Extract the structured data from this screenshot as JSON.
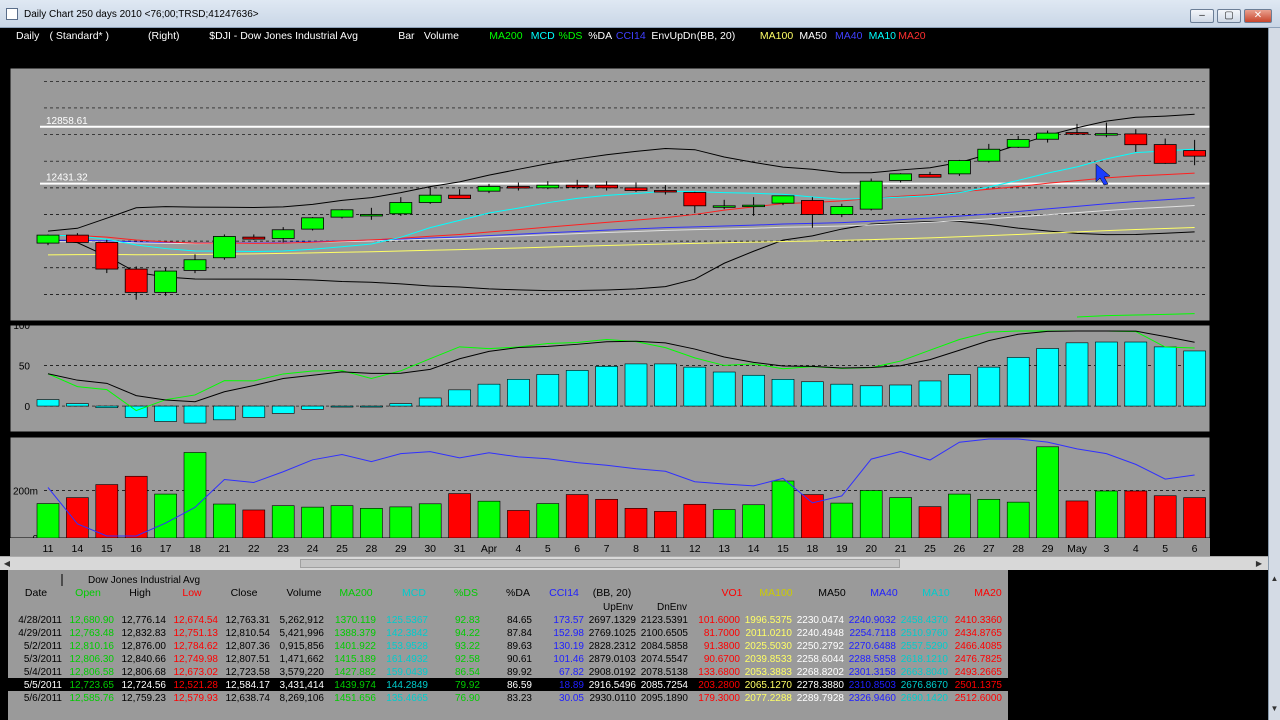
{
  "window": {
    "title": "Daily Chart 250 days 2010 <76;00;TRSD;41247636>",
    "buttons": [
      "–",
      "▢",
      "✕"
    ]
  },
  "header": {
    "items": [
      {
        "text": "Daily",
        "color": "#ffffff"
      },
      {
        "text": "(  Standard*  )",
        "color": "#ffffff"
      },
      {
        "text": "(Right)",
        "color": "#ffffff"
      },
      {
        "text": "$DJI - Dow Jones Industrial Avg",
        "color": "#ffffff"
      },
      {
        "text": "Bar",
        "color": "#ffffff"
      },
      {
        "text": "Volume",
        "color": "#ffffff"
      },
      {
        "text": "MA200",
        "color": "#00ff00"
      },
      {
        "text": "MCD",
        "color": "#00ffff"
      },
      {
        "text": "%DS",
        "color": "#00ff00"
      },
      {
        "text": "%DA",
        "color": "#ffffff"
      },
      {
        "text": "CCI14",
        "color": "#4040ff"
      },
      {
        "text": "EnvUpDn",
        "color": "#ffffff"
      },
      {
        "text": "(BB, 20)",
        "color": "#ffffff"
      },
      {
        "text": "MA100",
        "color": "#ffff66"
      },
      {
        "text": "MA50",
        "color": "#ffffff"
      },
      {
        "text": "MA40",
        "color": "#4040ff"
      },
      {
        "text": "MA10",
        "color": "#00ffff"
      },
      {
        "text": "MA20",
        "color": "#ff3030"
      }
    ]
  },
  "colors": {
    "up": "#00ff00",
    "down": "#ff0000",
    "macd": "#00ffff",
    "ma200": "#00ff00",
    "ma100": "#ffff66",
    "ma50": "#000000",
    "ma40": "#3030ff",
    "ma10": "#00ffff",
    "ma20": "#ff2020",
    "cci": "#3030ff",
    "bb": "#000000"
  },
  "price_panel": {
    "ylim": [
      11400,
      13300
    ],
    "ticks": [
      11400,
      11600,
      11800,
      12000,
      12200,
      12400,
      12600,
      12800,
      13000,
      13200
    ],
    "hlines": [
      {
        "value": 12858.61,
        "label": "12858.61"
      },
      {
        "value": 12431.32,
        "label": "12431.32"
      }
    ],
    "last_price_label": "12638.74"
  },
  "chart_data": [
    {
      "type": "candlestick",
      "categories": [
        "Mar 11",
        "Mar 14",
        "Mar 15",
        "Mar 16",
        "Mar 17",
        "Mar 18",
        "Mar 21",
        "Mar 22",
        "Mar 23",
        "Mar 24",
        "Mar 25",
        "Mar 28",
        "Mar 29",
        "Mar 30",
        "Mar 31",
        "Apr 1",
        "Apr 4",
        "Apr 5",
        "Apr 6",
        "Apr 7",
        "Apr 8",
        "Apr 11",
        "Apr 12",
        "Apr 13",
        "Apr 14",
        "Apr 15",
        "Apr 18",
        "Apr 19",
        "Apr 20",
        "Apr 21",
        "Apr 25",
        "Apr 26",
        "Apr 27",
        "Apr 28",
        "Apr 29",
        "May 2",
        "May 3",
        "May 4",
        "May 5",
        "May 6"
      ],
      "open": [
        11985,
        12045,
        11990,
        11790,
        11615,
        11780,
        11875,
        12030,
        12020,
        12090,
        12180,
        12200,
        12205,
        12290,
        12345,
        12375,
        12410,
        12400,
        12420,
        12420,
        12400,
        12380,
        12365,
        12260,
        12265,
        12285,
        12305,
        12200,
        12240,
        12455,
        12500,
        12505,
        12600,
        12705,
        12765,
        12815,
        12800,
        12805,
        12725,
        12680
      ],
      "high": [
        12050,
        12060,
        12010,
        11810,
        11800,
        11900,
        12050,
        12050,
        12105,
        12180,
        12240,
        12250,
        12330,
        12400,
        12390,
        12430,
        12440,
        12450,
        12460,
        12450,
        12440,
        12420,
        12370,
        12310,
        12330,
        12320,
        12330,
        12280,
        12470,
        12510,
        12520,
        12610,
        12730,
        12790,
        12830,
        12880,
        12890,
        12840,
        12770,
        12760
      ],
      "low": [
        11970,
        11990,
        11760,
        11560,
        11590,
        11760,
        11860,
        12010,
        11990,
        12080,
        12170,
        12160,
        12190,
        12280,
        12320,
        12360,
        12380,
        12390,
        12390,
        12380,
        12370,
        12350,
        12210,
        12240,
        12190,
        12270,
        12100,
        12180,
        12230,
        12440,
        12480,
        12490,
        12590,
        12700,
        12740,
        12800,
        12780,
        12670,
        12580,
        12570
      ],
      "close": [
        12045,
        11990,
        11790,
        11615,
        11775,
        11860,
        12035,
        12015,
        12085,
        12175,
        12235,
        12200,
        12290,
        12345,
        12320,
        12410,
        12405,
        12420,
        12405,
        12400,
        12380,
        12370,
        12265,
        12265,
        12270,
        12340,
        12200,
        12260,
        12450,
        12505,
        12480,
        12605,
        12690,
        12763,
        12811,
        12808,
        12807,
        12724,
        12584,
        12638
      ],
      "ylim": [
        11400,
        13300
      ],
      "ma200_visible": [
        11430,
        11440,
        11445,
        11450,
        11455
      ],
      "bb_upper_end": 12940,
      "bb_lower_end": 12090
    },
    {
      "type": "bar",
      "name": "MACD",
      "ticks": [
        0,
        50,
        100
      ],
      "right_ticks": [
        0,
        50,
        100
      ],
      "values": [
        8,
        3,
        -2,
        -14,
        -19,
        -21,
        -17,
        -14,
        -9,
        -4,
        0,
        0,
        3,
        10,
        20,
        27,
        33,
        39,
        44,
        49,
        52,
        52,
        48,
        42,
        38,
        33,
        30,
        27,
        25,
        26,
        31,
        39,
        48,
        60,
        71,
        78,
        79,
        79,
        73,
        68
      ]
    },
    {
      "type": "bar",
      "name": "Volume",
      "ticks": [
        {
          "v": 0,
          "label": "0"
        },
        {
          "v": 200,
          "label": "200m"
        }
      ],
      "right_ticks": [
        {
          "v": -200,
          "label": "-200"
        },
        {
          "v": 0,
          "label": "0"
        },
        {
          "v": 200,
          "label": "200"
        }
      ],
      "volume": [
        145,
        170,
        225,
        260,
        185,
        360,
        143,
        118,
        136,
        130,
        136,
        125,
        131,
        144,
        187,
        155,
        116,
        145,
        183,
        163,
        125,
        112,
        142,
        120,
        140,
        240,
        183,
        147,
        200,
        170,
        132,
        185,
        163,
        151,
        384,
        156,
        198,
        198,
        178,
        170
      ]
    }
  ],
  "x_axis_labels": [
    "11",
    "14",
    "15",
    "16",
    "17",
    "18",
    "21",
    "22",
    "23",
    "24",
    "25",
    "28",
    "29",
    "30",
    "31",
    "Apr",
    "4",
    "5",
    "6",
    "7",
    "8",
    "11",
    "12",
    "13",
    "14",
    "15",
    "18",
    "19",
    "20",
    "21",
    "25",
    "26",
    "27",
    "28",
    "29",
    "May",
    "3",
    "4",
    "5",
    "6"
  ],
  "table": {
    "top_title": "Dow Jones Industrial Avg",
    "headers": [
      {
        "text": "Date",
        "color": "#000000"
      },
      {
        "text": "Open",
        "color": "#00cc00"
      },
      {
        "text": "High",
        "color": "#000000"
      },
      {
        "text": "Low",
        "color": "#ff0000"
      },
      {
        "text": "Close",
        "color": "#000000"
      },
      {
        "text": "Volume",
        "color": "#000000"
      },
      {
        "text": "MA200",
        "color": "#00cc00"
      },
      {
        "text": "MCD",
        "color": "#00cccc"
      },
      {
        "text": "%DS",
        "color": "#00cc00"
      },
      {
        "text": "%DA",
        "color": "#000000"
      },
      {
        "text": "CCI14",
        "color": "#2020ff"
      },
      {
        "text": "(BB, 20)",
        "color": "#000000"
      },
      {
        "text": "VO1",
        "color": "#ff0000"
      },
      {
        "text": "MA100",
        "color": "#cccc00"
      },
      {
        "text": "MA50",
        "color": "#000000"
      },
      {
        "text": "MA40",
        "color": "#2020ff"
      },
      {
        "text": "MA10",
        "color": "#00cccc"
      },
      {
        "text": "MA20",
        "color": "#ff0000"
      }
    ],
    "sub_headers": [
      "UpEnv",
      "DnEnv"
    ],
    "rows": [
      [
        "4/28/2011",
        "12,680.90",
        "12,776.14",
        "12,674.54",
        "12,763.31",
        "5,262,912",
        "1370.119",
        "125.5367",
        "92.83",
        "84.65",
        "173.57",
        "2697.1329",
        "2123.5391",
        "101.6000",
        "1996.5375",
        "2230.0474",
        "2240.9032",
        "2458.4370",
        "2410.3360"
      ],
      [
        "4/29/2011",
        "12,763.48",
        "12,832.83",
        "12,751.13",
        "12,810.54",
        "5,421,996",
        "1388.379",
        "142.3842",
        "94.22",
        "87.84",
        "152.98",
        "2769.1025",
        "2100.6505",
        "81.7000",
        "2011.0210",
        "2240.4948",
        "2254.7118",
        "2510.9760",
        "2434.8765"
      ],
      [
        "5/2/2011",
        "12,810.16",
        "12,876.00",
        "12,784.62",
        "12,807.36",
        "0,915,856",
        "1401.922",
        "153.9528",
        "93.22",
        "89.63",
        "130.19",
        "2828.2312",
        "2084.5858",
        "91.3800",
        "2025.5030",
        "2250.2792",
        "2270.6488",
        "2557.5290",
        "2466.4085"
      ],
      [
        "5/3/2011",
        "12,806.30",
        "12,840.66",
        "12,749.98",
        "12,807.51",
        "1,471,662",
        "1415.189",
        "161.4932",
        "92.58",
        "90.61",
        "101.46",
        "2879.0103",
        "2074.5547",
        "90.6700",
        "2039.8533",
        "2258.6044",
        "2288.5858",
        "2618.1210",
        "2476.7825"
      ],
      [
        "5/4/2011",
        "12,806.58",
        "12,806.68",
        "12,673.02",
        "12,723.58",
        "3,579,220",
        "1427.882",
        "159.0439",
        "86.54",
        "89.92",
        "67.82",
        "2908.0192",
        "2078.5138",
        "133.6800",
        "2053.3883",
        "2268.8202",
        "2301.3158",
        "2663.8040",
        "2493.2665"
      ],
      [
        "5/5/2011",
        "12,723.65",
        "12,724.56",
        "12,521.28",
        "12,584.17",
        "3,431,414",
        "1439.974",
        "144.2849",
        "79.92",
        "86.59",
        "18.89",
        "2916.5496",
        "2085.7254",
        "203.2800",
        "2065.1270",
        "2278.3880",
        "2310.8503",
        "2676.8670",
        "2501.1375"
      ],
      [
        "5/6/2011",
        "12,585.76",
        "12,759.23",
        "12,579.93",
        "12,638.74",
        "8,269,106",
        "1451.656",
        "135.4665",
        "76.90",
        "83.23",
        "30.05",
        "2930.0110",
        "2095.1890",
        "179.3000",
        "2077.2288",
        "2289.7928",
        "2326.9460",
        "2690.1420",
        "2512.6000"
      ]
    ],
    "selected_row": 5
  }
}
